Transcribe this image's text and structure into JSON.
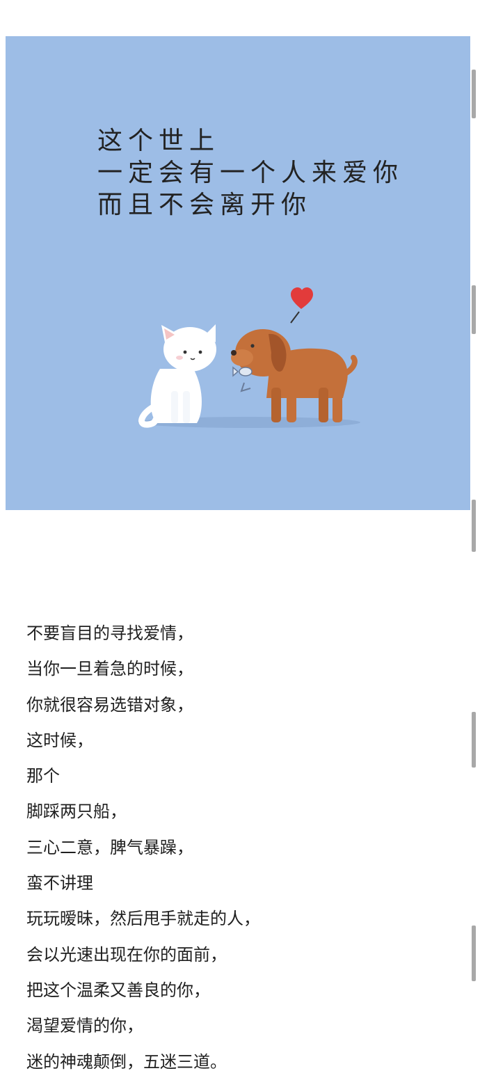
{
  "image_caption": {
    "lines": [
      "这个世上",
      "一定会有一个人来爱你",
      "而且不会离开你"
    ]
  },
  "poem": {
    "lines": [
      "不要盲目的寻找爱情，",
      "当你一旦着急的时候，",
      "你就很容易选错对象，",
      "这时候，",
      "那个",
      "脚踩两只船，",
      "三心二意，脾气暴躁，",
      "蛮不讲理",
      "玩玩暧昧，然后甩手就走的人，",
      "会以光速出现在你的面前，",
      "把这个温柔又善良的你，",
      "渴望爱情的你，",
      "迷的神魂颠倒，五迷三道。"
    ]
  },
  "colors": {
    "illustration_background": "#9dbde6",
    "heart": "#e23b3b",
    "dog": "#c4703a",
    "cat": "#ffffff",
    "text": "#1f1f1f"
  },
  "icons": [
    "cat-illustration",
    "dog-illustration",
    "heart-icon",
    "fish-icon"
  ]
}
